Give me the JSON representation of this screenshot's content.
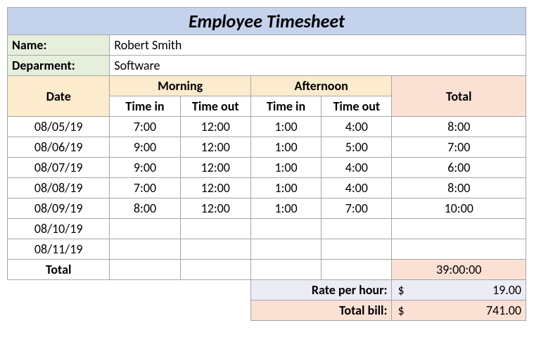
{
  "title": "Employee Timesheet",
  "name_label": "Name:",
  "name_value": "Robert Smith",
  "dept_label": "Deparment:",
  "dept_value": "Software",
  "headers": {
    "date": "Date",
    "morning": "Morning",
    "afternoon": "Afternoon",
    "total": "Total",
    "time_in": "Time in",
    "time_out": "Time out"
  },
  "rows": [
    {
      "date": "08/05/19",
      "m_in": "7:00",
      "m_out": "12:00",
      "a_in": "1:00",
      "a_out": "4:00",
      "total": "8:00"
    },
    {
      "date": "08/06/19",
      "m_in": "9:00",
      "m_out": "12:00",
      "a_in": "1:00",
      "a_out": "5:00",
      "total": "7:00"
    },
    {
      "date": "08/07/19",
      "m_in": "9:00",
      "m_out": "12:00",
      "a_in": "1:00",
      "a_out": "4:00",
      "total": "6:00"
    },
    {
      "date": "08/08/19",
      "m_in": "7:00",
      "m_out": "12:00",
      "a_in": "1:00",
      "a_out": "4:00",
      "total": "8:00"
    },
    {
      "date": "08/09/19",
      "m_in": "8:00",
      "m_out": "12:00",
      "a_in": "1:00",
      "a_out": "7:00",
      "total": "10:00"
    },
    {
      "date": "08/10/19",
      "m_in": "",
      "m_out": "",
      "a_in": "",
      "a_out": "",
      "total": ""
    },
    {
      "date": "08/11/19",
      "m_in": "",
      "m_out": "",
      "a_in": "",
      "a_out": "",
      "total": ""
    }
  ],
  "footer": {
    "total_label": "Total",
    "total_value": "39:00:00",
    "rate_label": "Rate per hour:",
    "rate_currency": "$",
    "rate_value": "19.00",
    "bill_label": "Total bill:",
    "bill_currency": "$",
    "bill_value": "741.00"
  }
}
